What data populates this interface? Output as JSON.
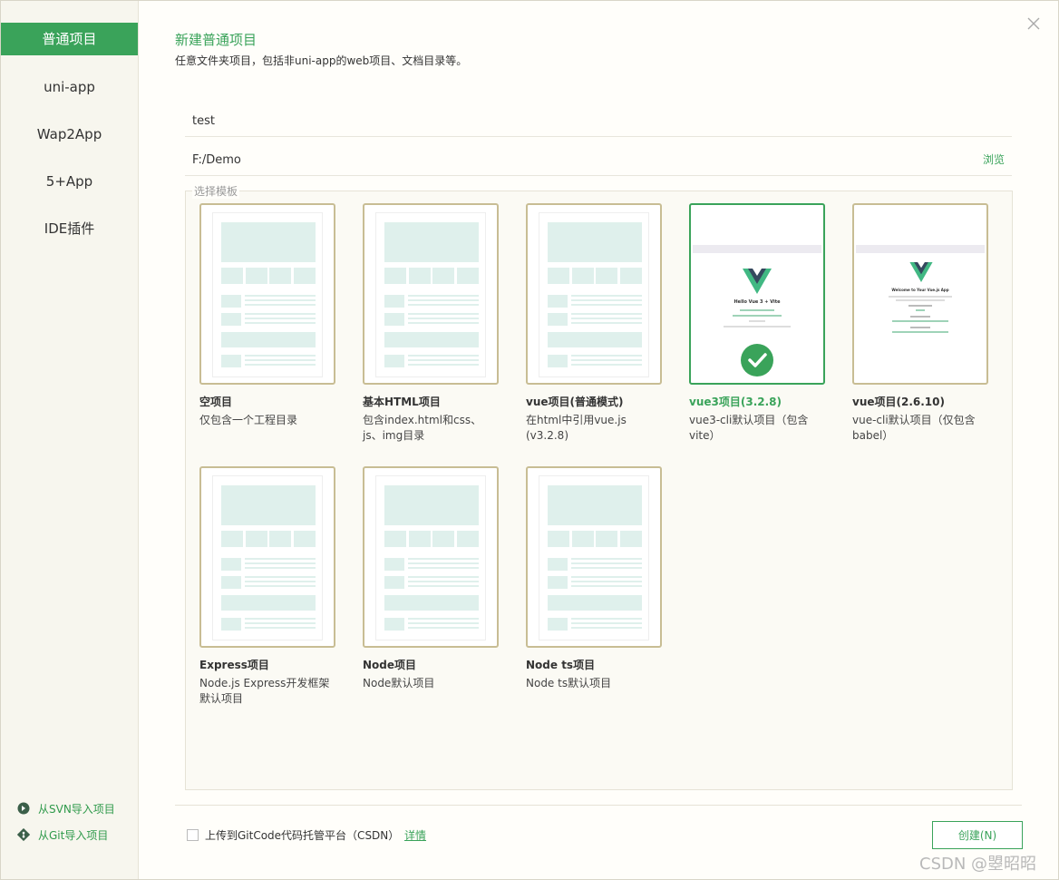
{
  "sidebar": {
    "items": [
      {
        "label": "普通项目",
        "active": true
      },
      {
        "label": "uni-app"
      },
      {
        "label": "Wap2App"
      },
      {
        "label": "5+App"
      },
      {
        "label": "IDE插件"
      }
    ],
    "import_svn": "从SVN导入项目",
    "import_git": "从Git导入项目"
  },
  "header": {
    "title": "新建普通项目",
    "subtitle": "任意文件夹项目，包括非uni-app的web项目、文档目录等。"
  },
  "form": {
    "project_name": "test",
    "location": "F:/Demo",
    "browse_label": "浏览",
    "template_legend": "选择模板"
  },
  "templates": [
    {
      "name": "空项目",
      "desc": "仅包含一个工程目录"
    },
    {
      "name": "基本HTML项目",
      "desc": "包含index.html和css、js、img目录"
    },
    {
      "name": "vue项目(普通模式)",
      "desc": "在html中引用vue.js (v3.2.8)"
    },
    {
      "name": "vue3项目(3.2.8)",
      "desc": "vue3-cli默认项目（包含vite）",
      "selected": true
    },
    {
      "name": "vue项目(2.6.10)",
      "desc": "vue-cli默认项目（仅包含babel）"
    },
    {
      "name": "Express项目",
      "desc": "Node.js Express开发框架默认项目"
    },
    {
      "name": "Node项目",
      "desc": "Node默认项目"
    },
    {
      "name": "Node ts项目",
      "desc": "Node ts默认项目"
    }
  ],
  "vue3_preview": {
    "heading": "Hello Vue 3 + Vite"
  },
  "vue2_preview": {
    "heading": "Welcome to Your Vue.js App"
  },
  "footer": {
    "upload_label": "上传到GitCode代码托管平台（CSDN）",
    "detail_label": "详情",
    "create_label": "创建(N)"
  },
  "watermark": "CSDN @曌昭昭",
  "colors": {
    "accent": "#3aa35a",
    "card_border": "#c8bd94",
    "mock": "#dff0ec"
  }
}
